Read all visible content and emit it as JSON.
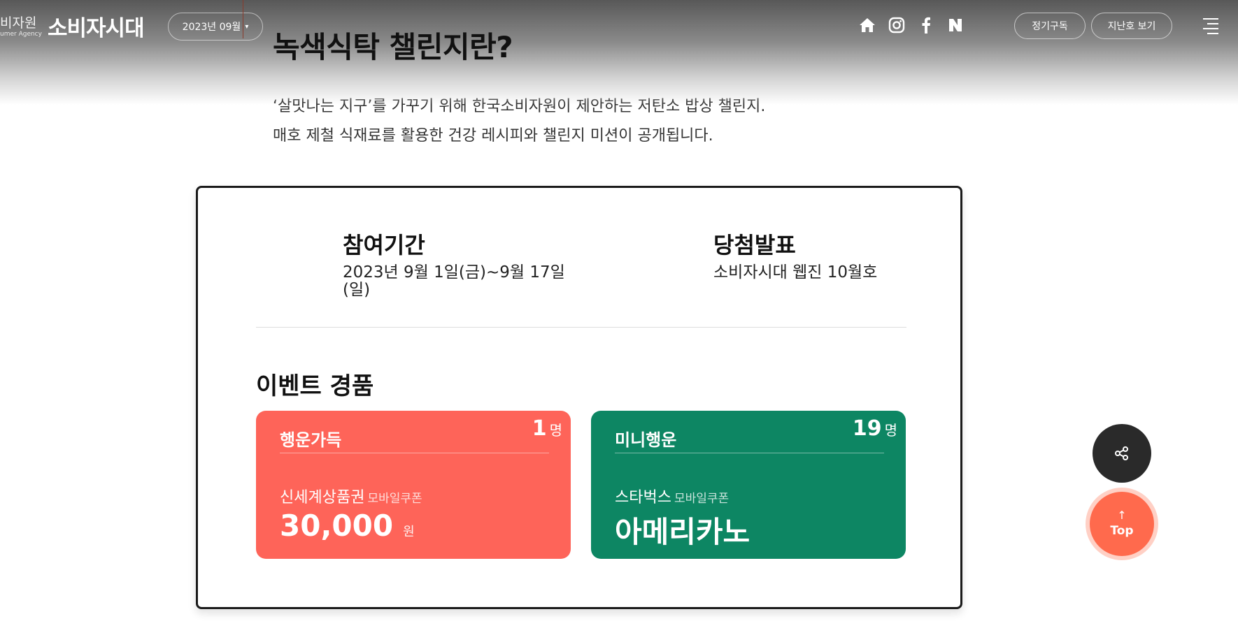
{
  "header": {
    "org_name": "비자원",
    "org_sub": "umer Agency",
    "logo": "소비자시대",
    "issue": "2023년 09월",
    "social": [
      "home-icon",
      "instagram-icon",
      "facebook-icon",
      "naver-icon"
    ],
    "subscribe_label": "정기구독",
    "back_issue_label": "지난호 보기"
  },
  "main": {
    "title": "녹색식탁 챌린지란?",
    "intro": [
      "‘살맛나는 지구’를 가꾸기 위해 한국소비자원이 제안하는 저탄소 밥상 챌린지.",
      "매호 제철 식재료를 활용한 건강 레시피와 챌린지 미션이 공개됩니다."
    ]
  },
  "event": {
    "period_label": "참여기간",
    "period_value": "2023년 9월 1일(금)~9월 17일 (일)",
    "announce_label": "당첨발표",
    "announce_value": "소비자시대 웹진 10월호",
    "prizes_title": "이벤트 경품",
    "prizes": [
      {
        "count": "1",
        "unit": "명",
        "tier": "행운가득",
        "item": "신세계상품권",
        "tag": "모바일쿠폰",
        "big": "30,000",
        "big_unit": "원",
        "color": "#fe6459"
      },
      {
        "count": "19",
        "unit": "명",
        "tier": "미니행운",
        "item": "스타벅스",
        "tag": "모바일쿠폰",
        "big": "아메리카노",
        "big_unit": "",
        "color": "#0d8663"
      }
    ]
  },
  "floating": {
    "top_label": "Top"
  }
}
